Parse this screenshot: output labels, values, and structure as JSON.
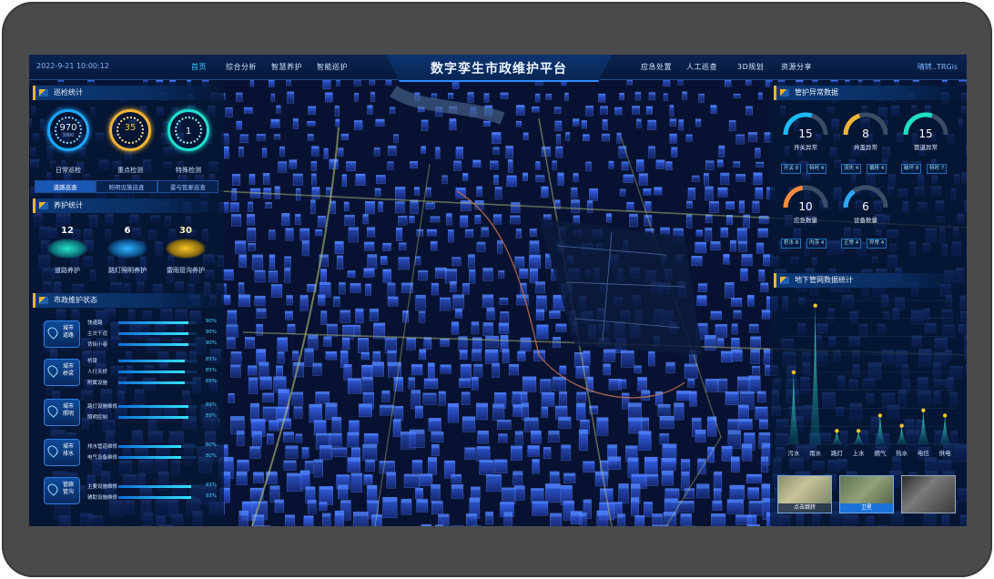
{
  "header": {
    "datetime": "2022-9-21  10:00:12",
    "title": "数字孪生市政维护平台",
    "nav_left": [
      {
        "label": "首页",
        "active": true
      },
      {
        "label": "综合分析"
      },
      {
        "label": "智慧养护"
      },
      {
        "label": "智能巡护"
      }
    ],
    "nav_right": [
      {
        "label": "应急处置"
      },
      {
        "label": "人工巡查"
      },
      {
        "label": "3D规划"
      },
      {
        "label": "资源分享"
      }
    ],
    "weather": "晴转..TRGis"
  },
  "patrol": {
    "title": "巡检统计",
    "rings": [
      {
        "value": "970",
        "sub": "1000",
        "label": "日常巡检",
        "color": "#1ea7ff"
      },
      {
        "value": "35",
        "sub": "",
        "label": "重点检测",
        "color": "#f2b434"
      },
      {
        "value": "1",
        "sub": "",
        "label": "特殊检测",
        "color": "#1ee0d0"
      }
    ],
    "tabs": [
      {
        "label": "道路巡查",
        "active": true
      },
      {
        "label": "照明设施巡查"
      },
      {
        "label": "雷与管廊巡查"
      }
    ]
  },
  "maintenance": {
    "title": "养护统计",
    "items": [
      {
        "value": "12",
        "label": "道路养护",
        "color": "#25e6c8"
      },
      {
        "value": "6",
        "label": "路灯照明养护",
        "color": "#2fb6ff"
      },
      {
        "value": "30",
        "label": "雷雨管沟养护",
        "color": "#f7c52a"
      }
    ]
  },
  "status": {
    "title": "市政维护状态",
    "groups": [
      {
        "name": "城市道路",
        "rows": [
          {
            "label": "快速路",
            "pct": "90%"
          },
          {
            "label": "主次干道",
            "pct": "90%"
          },
          {
            "label": "背街小巷",
            "pct": "90%"
          }
        ]
      },
      {
        "name": "城市桥梁",
        "rows": [
          {
            "label": "桥梁",
            "pct": "85%"
          },
          {
            "label": "人行天桥",
            "pct": "85%"
          },
          {
            "label": "附属设施",
            "pct": "85%"
          }
        ]
      },
      {
        "name": "城市照明",
        "rows": [
          {
            "label": "路灯设施维修",
            "pct": "89%"
          },
          {
            "label": "照明控制",
            "pct": "89%"
          }
        ]
      },
      {
        "name": "城市排水",
        "rows": [
          {
            "label": "排水管道维修",
            "pct": "80%"
          },
          {
            "label": "电气设备维修",
            "pct": "80%"
          }
        ]
      },
      {
        "name": "管廊管沟",
        "rows": [
          {
            "label": "主要设施维修",
            "pct": "93%"
          },
          {
            "label": "辅助设施维修",
            "pct": "93%"
          }
        ]
      }
    ]
  },
  "pipe_abnormal": {
    "title": "管护异常数据",
    "gauges": [
      {
        "value": "15",
        "label": "开关异常",
        "color": "#1fb8ff",
        "fraction": 0.6,
        "chips": [
          "开关 8",
          "特时 4"
        ]
      },
      {
        "value": "8",
        "label": "井盖异常",
        "color": "#f2b434",
        "fraction": 0.4,
        "chips": [
          "流失 4",
          "偏移 4"
        ]
      },
      {
        "value": "15",
        "label": "管道异常",
        "color": "#1ee0c8",
        "fraction": 0.6,
        "chips": [
          "破坏 8",
          "特时 7"
        ]
      },
      {
        "value": "10",
        "label": "应急数量",
        "color": "#ff8a3d",
        "fraction": 0.45,
        "chips": [
          "积水 8",
          "内涝 4"
        ]
      },
      {
        "value": "6",
        "label": "设备数量",
        "color": "#2fa6ff",
        "fraction": 0.3,
        "chips": [
          "正常 4",
          "异常 4"
        ]
      }
    ]
  },
  "underground": {
    "title": "地下管网数据统计",
    "chart_data": {
      "type": "bar",
      "categories": [
        "污水",
        "雨水",
        "路灯",
        "上水",
        "燃气",
        "热水",
        "电信",
        "供电"
      ],
      "values": [
        70,
        135,
        13,
        13,
        28,
        18,
        33,
        28
      ],
      "ylim": [
        0,
        140
      ]
    }
  },
  "thumbnails": [
    {
      "label": "点击跳转",
      "active": false
    },
    {
      "label": "卫星",
      "active": true
    },
    {
      "label": "",
      "active": false
    }
  ]
}
